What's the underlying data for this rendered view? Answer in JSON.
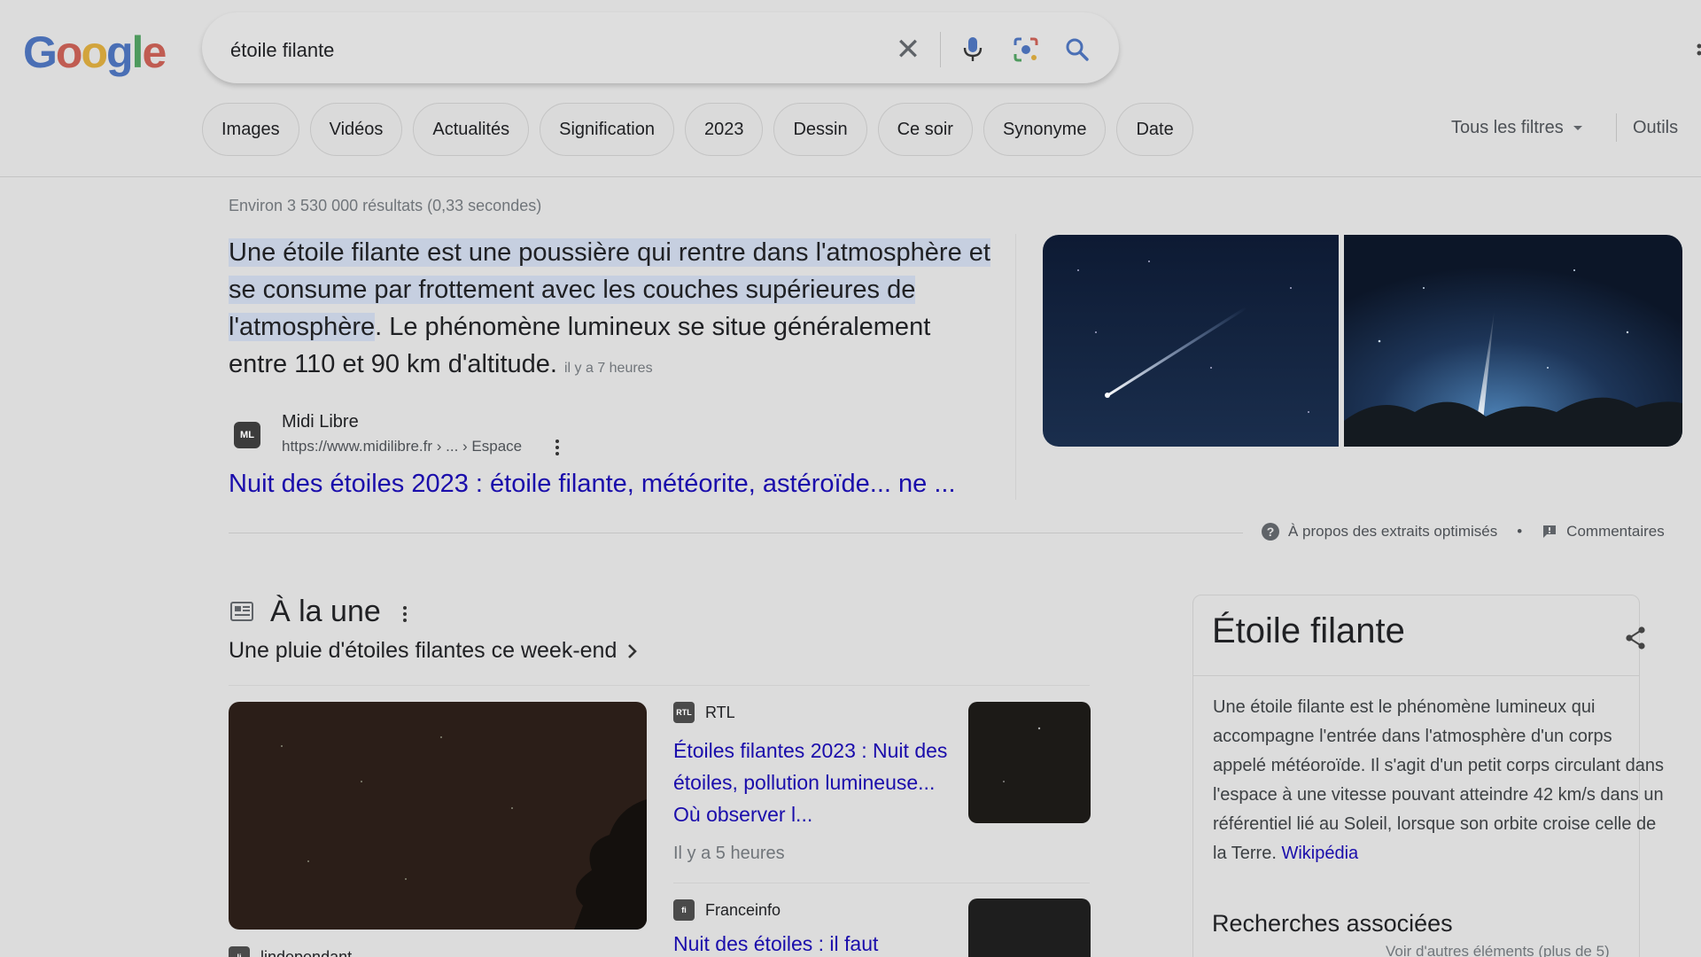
{
  "logo": {
    "letters": [
      "G",
      "o",
      "o",
      "g",
      "l",
      "e"
    ],
    "colors": [
      "#4a6fb5",
      "#c05c52",
      "#d2a43c",
      "#4a6fb5",
      "#4e9a5e",
      "#c05c52"
    ]
  },
  "search": {
    "query": "étoile filante"
  },
  "chips": [
    "Images",
    "Vidéos",
    "Actualités",
    "Signification",
    "2023",
    "Dessin",
    "Ce soir",
    "Synonyme",
    "Date"
  ],
  "filters": {
    "all_filters": "Tous les filtres",
    "tools": "Outils"
  },
  "stats": "Environ 3 530 000 résultats (0,33 secondes)",
  "snippet": {
    "text_highlighted": "Une étoile filante est une poussière qui rentre dans l'atmosphère et se consume par frottement avec les couches supérieures de l'atmosphère",
    "text_rest": ". Le phénomène lumineux se situe généralement entre 110 et 90 km d'altitude.",
    "time": "il y a 7 heures",
    "source_icon": "ML",
    "source_name": "Midi Libre",
    "source_url": "https://www.midilibre.fr › ... › Espace",
    "link": "Nuit des étoiles 2023 : étoile filante, météorite, astéroïde... ne ...",
    "about": "À propos des extraits optimisés",
    "separator": "•",
    "feedback": "Commentaires"
  },
  "top_stories": {
    "title": "À la une",
    "subtitle": "Une pluie d'étoiles filantes ce week-end",
    "items": [
      {
        "source": "RTL",
        "icon": "RTL",
        "title": "Étoiles filantes 2023 : Nuit des étoiles, pollution lumineuse... Où observer l...",
        "time": "Il y a 5 heures"
      },
      {
        "source": "Franceinfo",
        "icon": "fi",
        "title": "Nuit des étoiles : il faut"
      },
      {
        "source": "lindependant",
        "icon": "li"
      }
    ]
  },
  "knowledge_panel": {
    "title": "Étoile filante",
    "description": "Une étoile filante est le phénomène lumineux qui accompagne l'entrée dans l'atmosphère d'un corps appelé météoroïde. Il s'agit d'un petit corps circulant dans l'espace à une vitesse pouvant atteindre 42 km/s dans un référentiel lié au Soleil, lorsque son orbite croise celle de la Terre.",
    "source_link": "Wikipédia",
    "related_title": "Recherches associées",
    "more": "Voir d'autres éléments (plus de 5)"
  },
  "icons": [
    "clear-icon",
    "mic-icon",
    "lens-icon",
    "search-icon",
    "dropdown-icon",
    "kebab-menu-icon",
    "help-icon",
    "feedback-icon",
    "news-icon",
    "chevron-right-icon",
    "share-icon"
  ]
}
